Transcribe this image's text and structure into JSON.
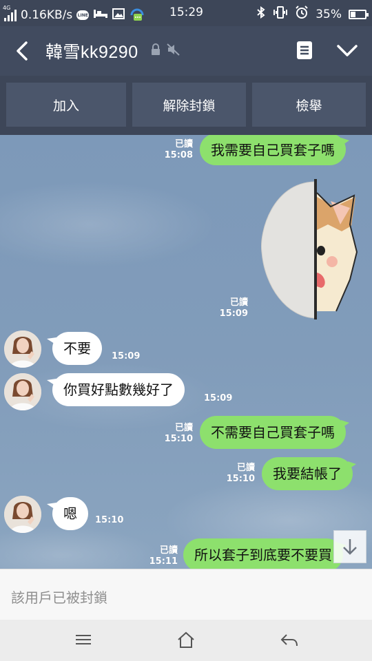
{
  "status": {
    "network": "4G",
    "speed": "0.16KB/s",
    "line_badge": "LINE",
    "time": "15:29",
    "battery": "35%",
    "battery_level": 0.35
  },
  "header": {
    "title": "韓雪kk9290"
  },
  "actions": {
    "add_label": "加入",
    "unblock_label": "解除封鎖",
    "report_label": "檢舉"
  },
  "messages": [
    {
      "from": "me",
      "text": "我需要自己買套子嗎",
      "read": "已讀",
      "time": "15:08"
    },
    {
      "from": "me",
      "type": "sticker",
      "sticker": "dog-peeking-sticker",
      "read": "已讀",
      "time": "15:09"
    },
    {
      "from": "them",
      "text": "不要",
      "time": "15:09"
    },
    {
      "from": "them",
      "text": "你買好點數幾好了",
      "time": "15:09"
    },
    {
      "from": "me",
      "text": "不需要自己買套子嗎",
      "read": "已讀",
      "time": "15:10"
    },
    {
      "from": "me",
      "text": "我要結帳了",
      "read": "已讀",
      "time": "15:10"
    },
    {
      "from": "them",
      "text": "嗯",
      "time": "15:10"
    },
    {
      "from": "me",
      "text": "所以套子到底要不要買",
      "read": "已讀",
      "time": "15:11"
    }
  ],
  "blocked_notice": "該用戶已被封鎖",
  "colors": {
    "header_bg": "#414b5f",
    "my_bubble": "#8de06d",
    "their_bubble": "#ffffff",
    "chat_bg": "#7f9ab8"
  }
}
